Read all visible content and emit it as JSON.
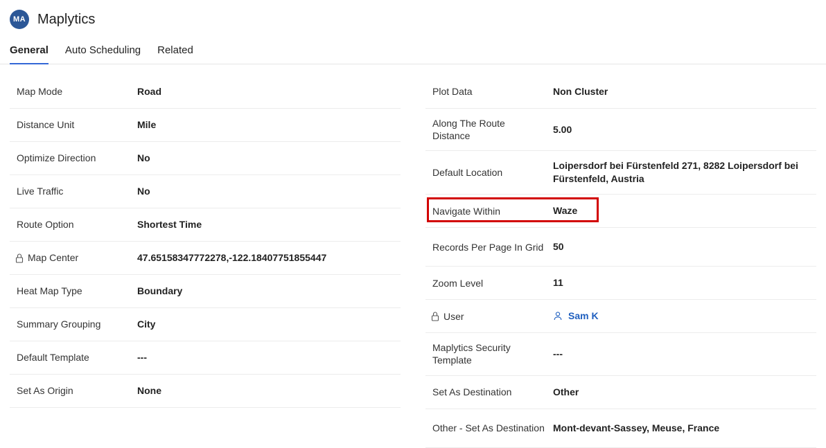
{
  "header": {
    "avatar_initials": "MA",
    "title": "Maplytics"
  },
  "tabs": [
    {
      "label": "General"
    },
    {
      "label": "Auto Scheduling"
    },
    {
      "label": "Related"
    }
  ],
  "left": {
    "map_mode": {
      "label": "Map Mode",
      "value": "Road"
    },
    "distance_unit": {
      "label": "Distance Unit",
      "value": "Mile"
    },
    "optimize_dir": {
      "label": "Optimize Direction",
      "value": "No"
    },
    "live_traffic": {
      "label": "Live Traffic",
      "value": "No"
    },
    "route_option": {
      "label": "Route Option",
      "value": "Shortest Time"
    },
    "map_center": {
      "label": "Map Center",
      "value": "47.65158347772278,-122.18407751855447"
    },
    "heat_map_type": {
      "label": "Heat Map Type",
      "value": "Boundary"
    },
    "summary_grouping": {
      "label": "Summary Grouping",
      "value": "City"
    },
    "default_template": {
      "label": "Default Template",
      "value": "---"
    },
    "set_as_origin": {
      "label": "Set As Origin",
      "value": "None"
    }
  },
  "right": {
    "plot_data": {
      "label": "Plot Data",
      "value": "Non Cluster"
    },
    "along_route": {
      "label": "Along The Route Distance",
      "value": "5.00"
    },
    "default_location": {
      "label": "Default Location",
      "value": "Loipersdorf bei Fürstenfeld 271, 8282 Loipersdorf bei Fürstenfeld, Austria"
    },
    "navigate_within": {
      "label": "Navigate Within",
      "value": "Waze"
    },
    "records_per_page": {
      "label": "Records Per Page In Grid",
      "value": "50"
    },
    "zoom_level": {
      "label": "Zoom Level",
      "value": "11"
    },
    "user": {
      "label": "User",
      "value": "Sam K"
    },
    "security_template": {
      "label": "Maplytics Security Template",
      "value": "---"
    },
    "set_as_dest": {
      "label": "Set As Destination",
      "value": "Other"
    },
    "other_dest": {
      "label": "Other - Set As Destination",
      "value": "Mont-devant-Sassey, Meuse, France"
    }
  }
}
